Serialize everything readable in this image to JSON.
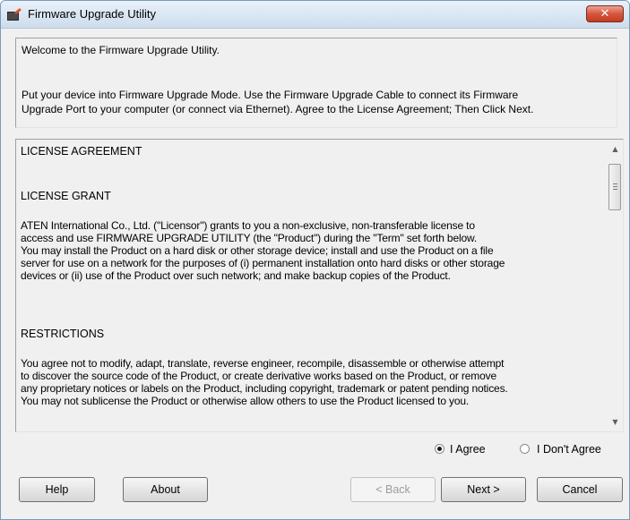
{
  "window": {
    "title": "Firmware Upgrade Utility",
    "close_glyph": "✕"
  },
  "welcome": {
    "line1": "Welcome to the Firmware Upgrade Utility.",
    "line2": "Put your device into Firmware Upgrade Mode. Use the Firmware Upgrade Cable to connect its Firmware",
    "line3": "Upgrade Port to your computer (or connect via Ethernet). Agree to the License Agreement; Then Click Next."
  },
  "license": {
    "heading": "LICENSE AGREEMENT",
    "grant_heading": "LICENSE GRANT",
    "grant_lines": [
      "ATEN International Co., Ltd. (\"Licensor\") grants to you a non-exclusive, non-transferable license to",
      "access and use FIRMWARE UPGRADE UTILITY (the \"Product\") during the \"Term\" set forth below.",
      "You may install the Product on a hard disk or other storage device; install and use the Product on a file",
      "server for use on a network for the purposes of (i) permanent installation onto hard disks or other storage",
      "devices or (ii) use of the Product over such network; and make backup copies of the Product."
    ],
    "restrictions_heading": "RESTRICTIONS",
    "restrictions_lines": [
      "You agree not to modify, adapt, translate, reverse engineer, recompile, disassemble or otherwise attempt",
      "to discover the source code of the Product, or create derivative works based on the Product, or remove",
      "any proprietary notices or labels on the Product, including copyright, trademark or patent pending notices.",
      "You may not sublicense the Product or otherwise allow others to use the Product licensed to you."
    ],
    "scroll_up_glyph": "▲",
    "scroll_down_glyph": "▼"
  },
  "agreement": {
    "agree_label": "I Agree",
    "disagree_label": "I Don't Agree",
    "selected": "agree"
  },
  "buttons": {
    "help": "Help",
    "about": "About",
    "back": "< Back",
    "next": "Next >",
    "cancel": "Cancel"
  }
}
